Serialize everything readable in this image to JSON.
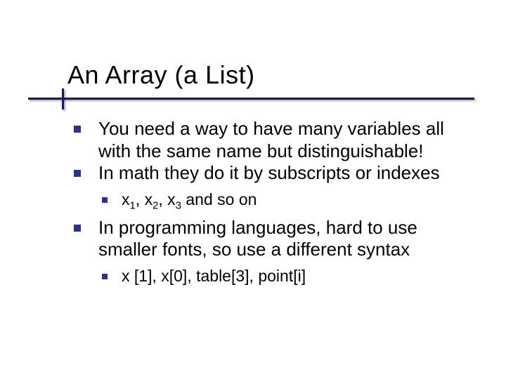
{
  "title": "An Array (a List)",
  "bullets": {
    "b1": "You need a way to have many variables all with the same name but distinguishable!",
    "b2": "In math they do it by subscripts or indexes",
    "b2a_pre": "x",
    "b2a_s1": "1",
    "b2a_m1": ", x",
    "b2a_s2": "2",
    "b2a_m2": ", x",
    "b2a_s3": "3",
    "b2a_post": " and so on",
    "b3": "In programming languages, hard to use smaller fonts, so use a different syntax",
    "b3a": "x [1], x[0], table[3], point[i]"
  }
}
